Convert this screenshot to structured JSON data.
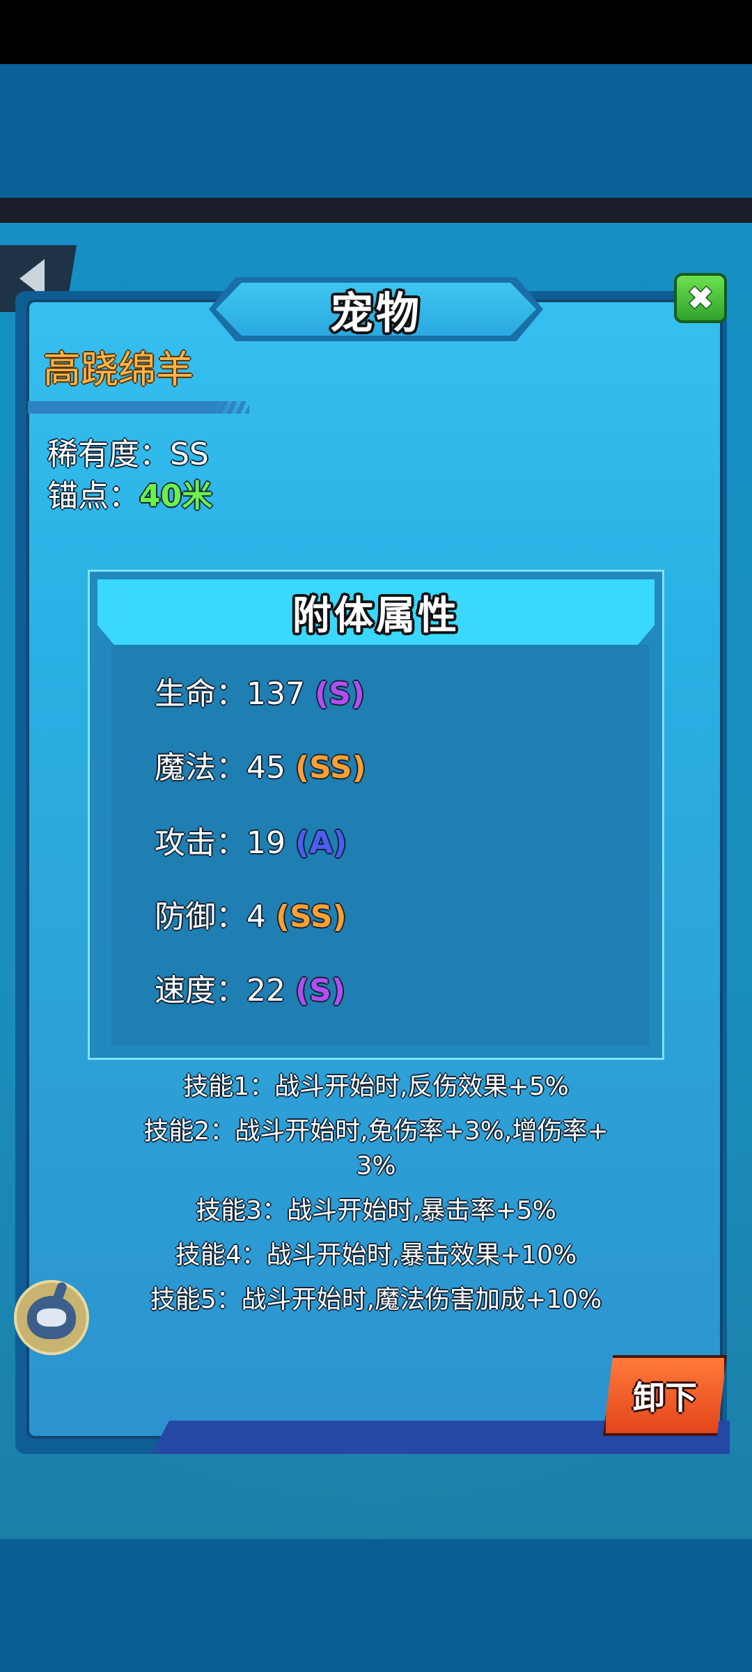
{
  "title": "宠物",
  "close_icon": "✖",
  "pet": {
    "name": "高跷绵羊",
    "rarity_label": "稀有度：",
    "rarity_value": "SS",
    "anchor_label": "锚点：",
    "anchor_value": "40米"
  },
  "attributes": {
    "title": "附体属性",
    "rows": [
      {
        "label": "生命：",
        "value": "137",
        "grade": "(S)"
      },
      {
        "label": "魔法：",
        "value": "45",
        "grade": "(SS)"
      },
      {
        "label": "攻击：",
        "value": "19",
        "grade": "(A)"
      },
      {
        "label": "防御：",
        "value": "4",
        "grade": "(SS)"
      },
      {
        "label": "速度：",
        "value": "22",
        "grade": "(S)"
      }
    ]
  },
  "skills": [
    "技能1：战斗开始时,反伤效果+5%",
    "技能2：战斗开始时,免伤率+3%,增伤率+",
    "3%",
    "技能3：战斗开始时,暴击率+5%",
    "技能4：战斗开始时,暴击效果+10%",
    "技能5：战斗开始时,魔法伤害加成+10%"
  ],
  "unequip_label": "卸下",
  "icons": {
    "back": "back-arrow-icon",
    "close": "close-icon",
    "avatar": "character-avatar-icon"
  },
  "colors": {
    "grade_S": "#b04ff0",
    "grade_SS": "#ffa032",
    "grade_A": "#4b5ef0",
    "pet_name": "#ffb54a",
    "anchor": "#6cf04c"
  }
}
